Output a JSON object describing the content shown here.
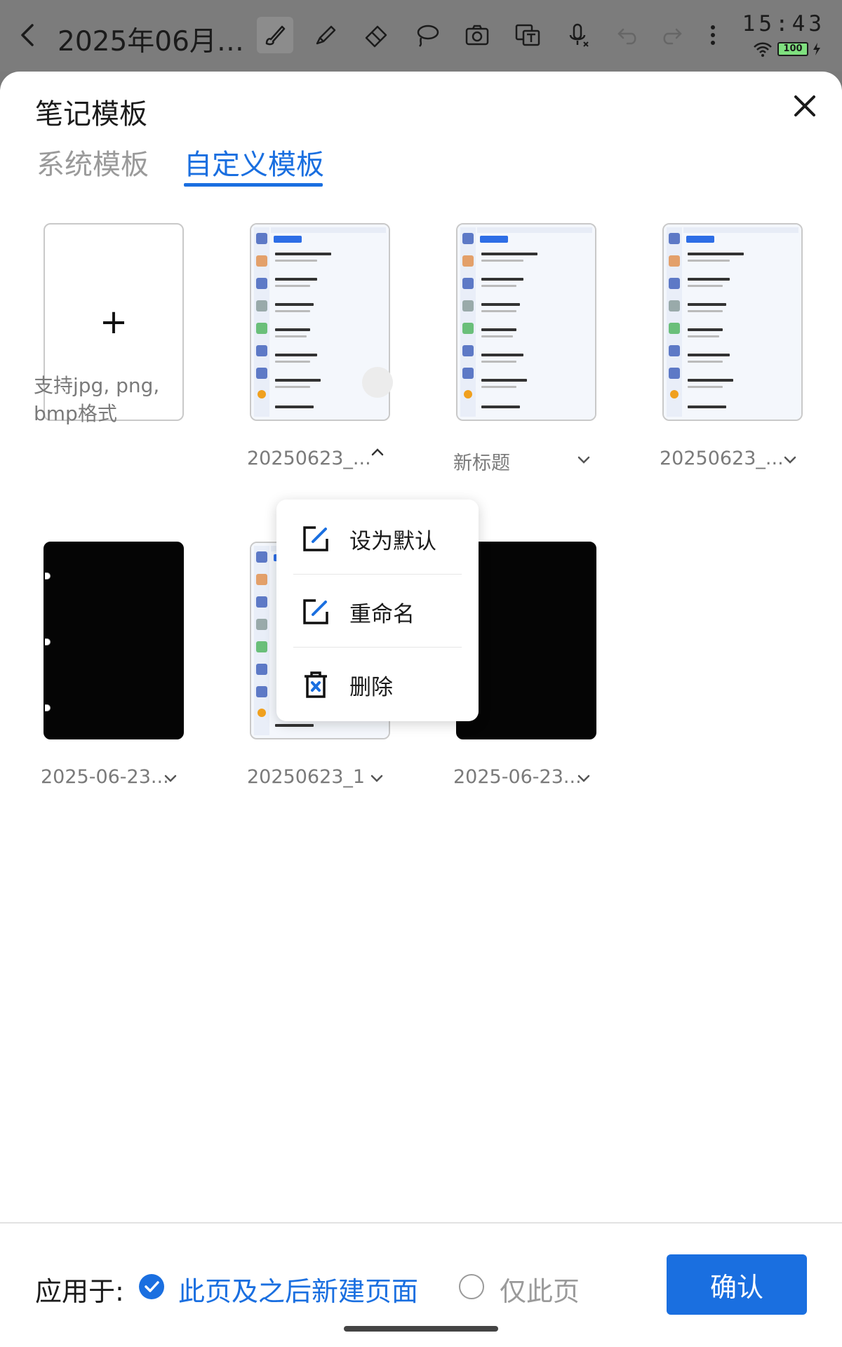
{
  "topbar": {
    "title": "2025年06月2...",
    "tools": [
      "brush-icon",
      "highlighter-icon",
      "eraser-icon",
      "lasso-icon",
      "camera-icon",
      "text-recognize-icon",
      "voice-icon",
      "undo-icon",
      "redo-icon",
      "more-icon"
    ],
    "active_tool": "brush-icon",
    "clock": "15:43",
    "battery": "100"
  },
  "sheet": {
    "title": "笔记模板",
    "tabs": [
      {
        "label": "系统模板",
        "active": false
      },
      {
        "label": "自定义模板",
        "active": true
      }
    ]
  },
  "templates": {
    "add_hint": "支持jpg, png, bmp格式",
    "items": [
      {
        "label": "20250623_...",
        "thumb": "screenshot",
        "menu_open": true
      },
      {
        "label": "新标题",
        "thumb": "screenshot",
        "menu_open": false
      },
      {
        "label": "20250623_...",
        "thumb": "screenshot",
        "menu_open": false
      },
      {
        "label": "2025-06-23...",
        "thumb": "black",
        "menu_open": false
      },
      {
        "label": "20250623_1",
        "thumb": "screenshot",
        "menu_open": false
      },
      {
        "label": "2025-06-23...",
        "thumb": "black",
        "menu_open": false
      }
    ]
  },
  "context_menu": {
    "items": [
      {
        "label": "设为默认",
        "icon": "edit-square-icon"
      },
      {
        "label": "重命名",
        "icon": "edit-square-icon"
      },
      {
        "label": "删除",
        "icon": "trash-icon"
      }
    ]
  },
  "footer": {
    "apply_label": "应用于:",
    "option_all": "此页及之后新建页面",
    "option_this": "仅此页",
    "selected": "option_all",
    "confirm": "确认"
  },
  "colors": {
    "accent": "#1a6fe0",
    "muted": "#9a9a9a",
    "toolbar": "#7c7c7c"
  }
}
